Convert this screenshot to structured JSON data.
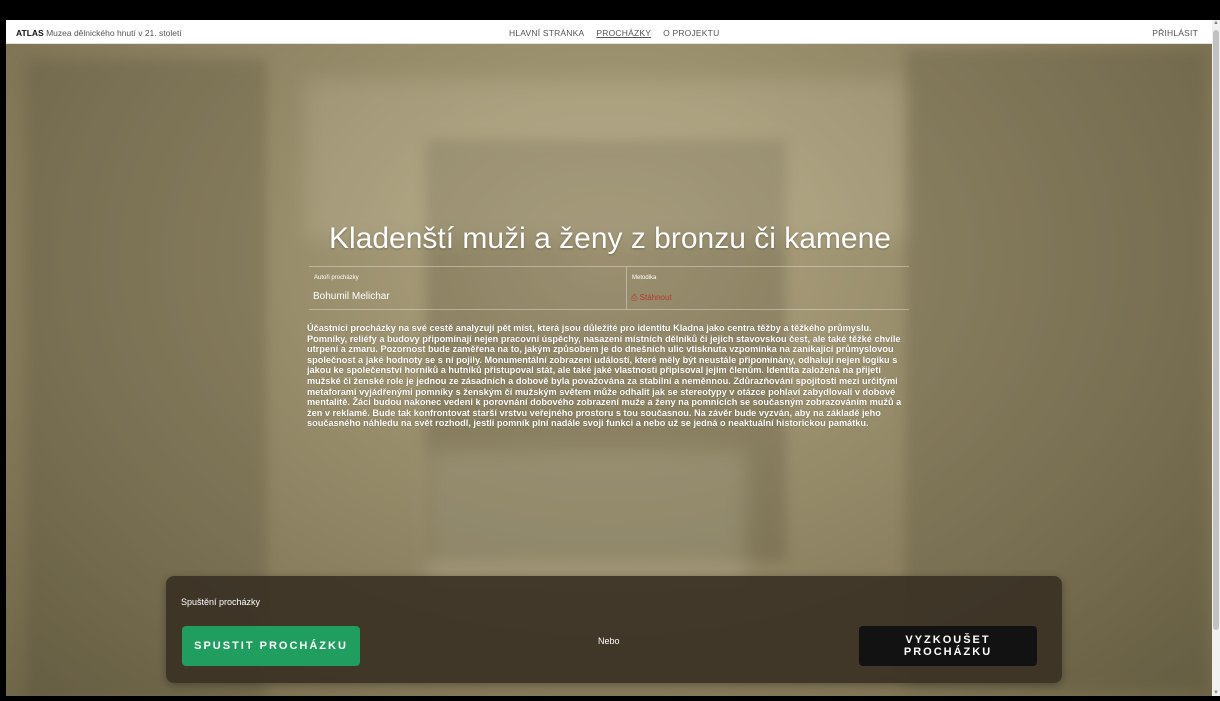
{
  "header": {
    "brand_bold": "ATLAS",
    "brand_rest": "Muzea dělnického hnutí v 21. století",
    "nav": [
      "HLAVNÍ STRÁNKA",
      "PROCHÁZKY",
      "O PROJEKTU"
    ],
    "nav_active": "PROCHÁZKY",
    "login": "PŘIHLÁSIT"
  },
  "walk": {
    "title": "Kladenští muži a ženy z bronzu či kamene",
    "authors_label": "Autoři procházky",
    "authors_value": "Bohumil Melichar",
    "methodology_label": "Metodika",
    "methodology_value": "Stáhnout",
    "description": "Účastníci procházky na své cestě analyzují pět míst, která jsou důležité pro identitu Kladna jako centra těžby a těžkého průmyslu. Pomníky, reliéfy a budovy připomínají nejen pracovní úspěchy, nasazení místních dělníků či jejich stavovskou čest, ale také těžké chvíle utrpení a zmaru. Pozornost bude zaměřena na to, jakým způsobem je do dnešních ulic vtisknuta vzpomínka na zanikající průmyslovou společnost a jaké hodnoty se s ní pojily. Monumentální zobrazení událostí, které měly být neustále připomínány, odhalují nejen logiku s jakou ke společenství horníků a hutníků přistupoval stát, ale také jaké vlastnosti připisoval jejím členům. Identita založená na přijetí mužské či ženské role je jednou ze zásadních a dobově byla považována za stabilní a neměnnou. Zdůrazňování spojitosti mezi určitými metaforami vyjádřenými pomníky s ženským či mužským světem může odhalit jak se stereotypy v otázce pohlaví zabydlovali v dobové mentalitě. Žáci budou nakonec vedeni k porovnání dobového zobrazení muže a ženy na pomnících se současným zobrazováním mužů a žen v reklamě. Bude tak konfrontovat starší vrstvu veřejného prostoru s tou současnou. Na závěr bude vyzván, aby na základě jeho současného náhledu na svět rozhodl, jestli pomník plní nadále svoji funkci a nebo už se jedná o neaktuální historickou památku."
  },
  "launch": {
    "label": "Spuštění procházky",
    "start_button": "SPUSTIT PROCHÁZKU",
    "or_text": "Nebo",
    "try_button": "VYZKOUŠET PROCHÁZKU"
  },
  "colors": {
    "start_button": "#1f9e5f",
    "try_button": "#121212",
    "panel": "#383024",
    "methodology_link": "#b3392e"
  }
}
